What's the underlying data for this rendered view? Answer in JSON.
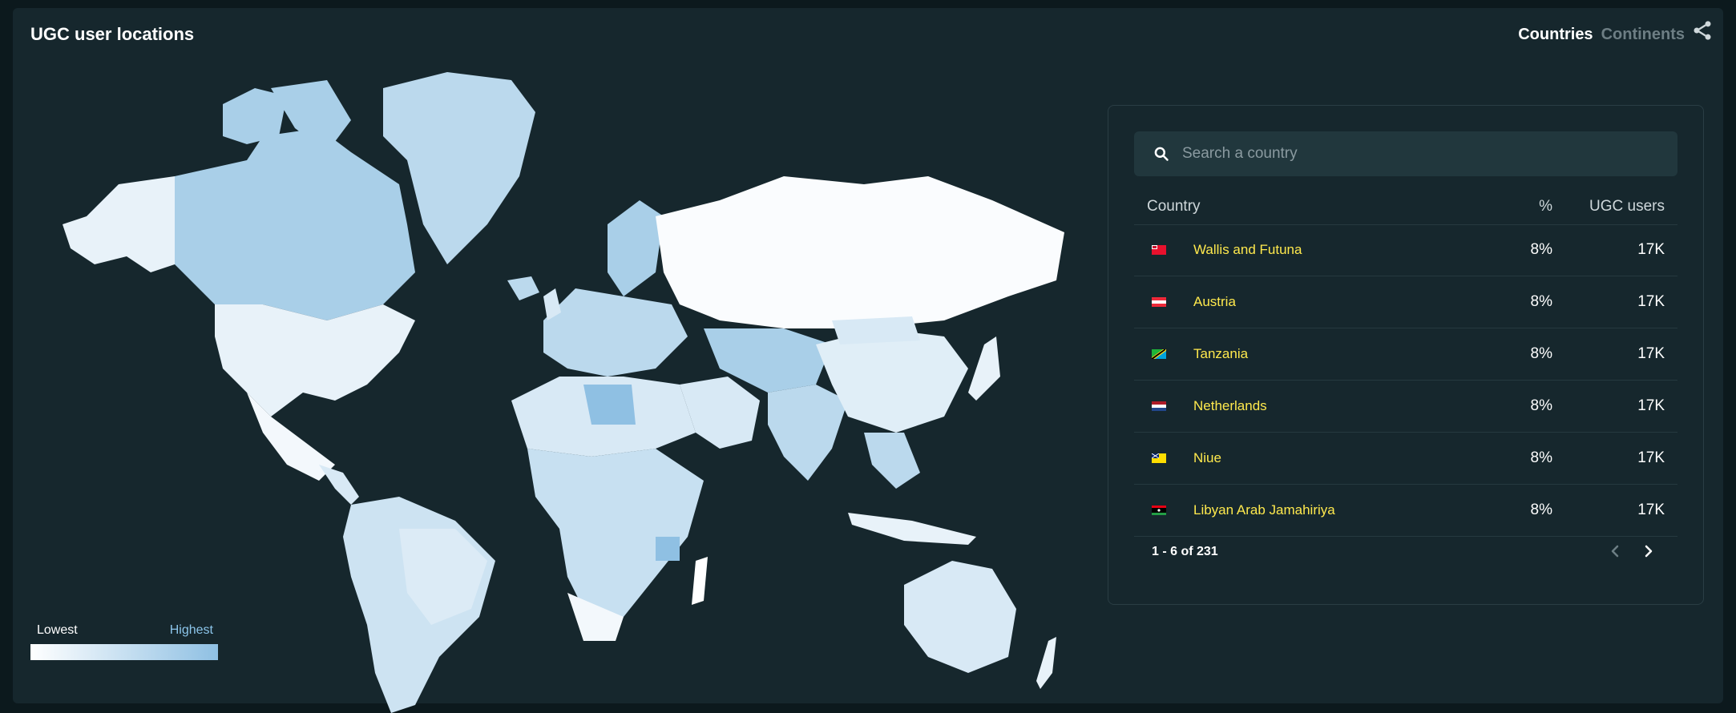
{
  "title": "UGC user locations",
  "toggle": {
    "countries": "Countries",
    "continents": "Continents"
  },
  "legend": {
    "low": "Lowest",
    "high": "Highest",
    "low_color": "#ffffff",
    "high_color": "#8fc0e3"
  },
  "search": {
    "placeholder": "Search a country"
  },
  "table": {
    "headers": {
      "country": "Country",
      "pct": "%",
      "users": "UGC users"
    },
    "rows": [
      {
        "name": "Wallis and Futuna",
        "pct": "8%",
        "users": "17K",
        "flag": "wallis-and-futuna-flag"
      },
      {
        "name": "Austria",
        "pct": "8%",
        "users": "17K",
        "flag": "austria-flag"
      },
      {
        "name": "Tanzania",
        "pct": "8%",
        "users": "17K",
        "flag": "tanzania-flag"
      },
      {
        "name": "Netherlands",
        "pct": "8%",
        "users": "17K",
        "flag": "netherlands-flag"
      },
      {
        "name": "Niue",
        "pct": "8%",
        "users": "17K",
        "flag": "niue-flag"
      },
      {
        "name": "Libyan Arab Jamahiriya",
        "pct": "8%",
        "users": "17K",
        "flag": "libya-flag"
      }
    ],
    "pagination": "1 - 6 of 231"
  },
  "colors": {
    "background": "#16272d",
    "accent_text": "#ffe94d",
    "map_light": "#ffffff",
    "map_dark": "#8fc0e3"
  }
}
